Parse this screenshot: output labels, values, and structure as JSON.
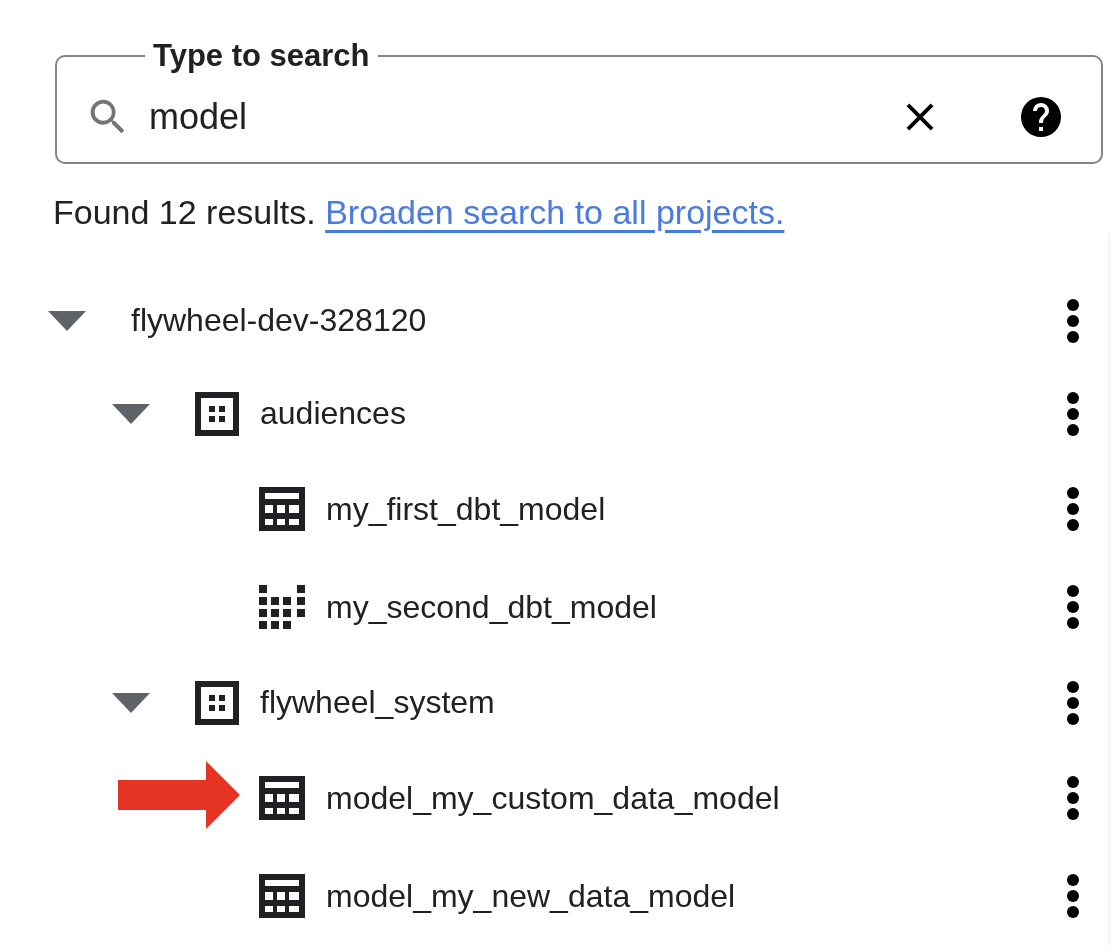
{
  "search": {
    "label": "Type to search",
    "value": "model"
  },
  "results": {
    "summary": "Found 12 results.",
    "link": "Broaden search to all projects."
  },
  "tree": [
    {
      "kind": "project",
      "label": "flywheel-dev-328120",
      "expanded": true,
      "pointed": false,
      "children": [
        {
          "kind": "dataset",
          "label": "audiences",
          "expanded": true,
          "pointed": false,
          "children": [
            {
              "kind": "table",
              "label": "my_first_dbt_model",
              "pointed": false
            },
            {
              "kind": "view",
              "label": "my_second_dbt_model",
              "pointed": false
            }
          ]
        },
        {
          "kind": "dataset",
          "label": "flywheel_system",
          "expanded": true,
          "pointed": false,
          "children": [
            {
              "kind": "table",
              "label": "model_my_custom_data_model",
              "pointed": true
            },
            {
              "kind": "table",
              "label": "model_my_new_data_model",
              "pointed": false
            }
          ]
        }
      ]
    }
  ]
}
